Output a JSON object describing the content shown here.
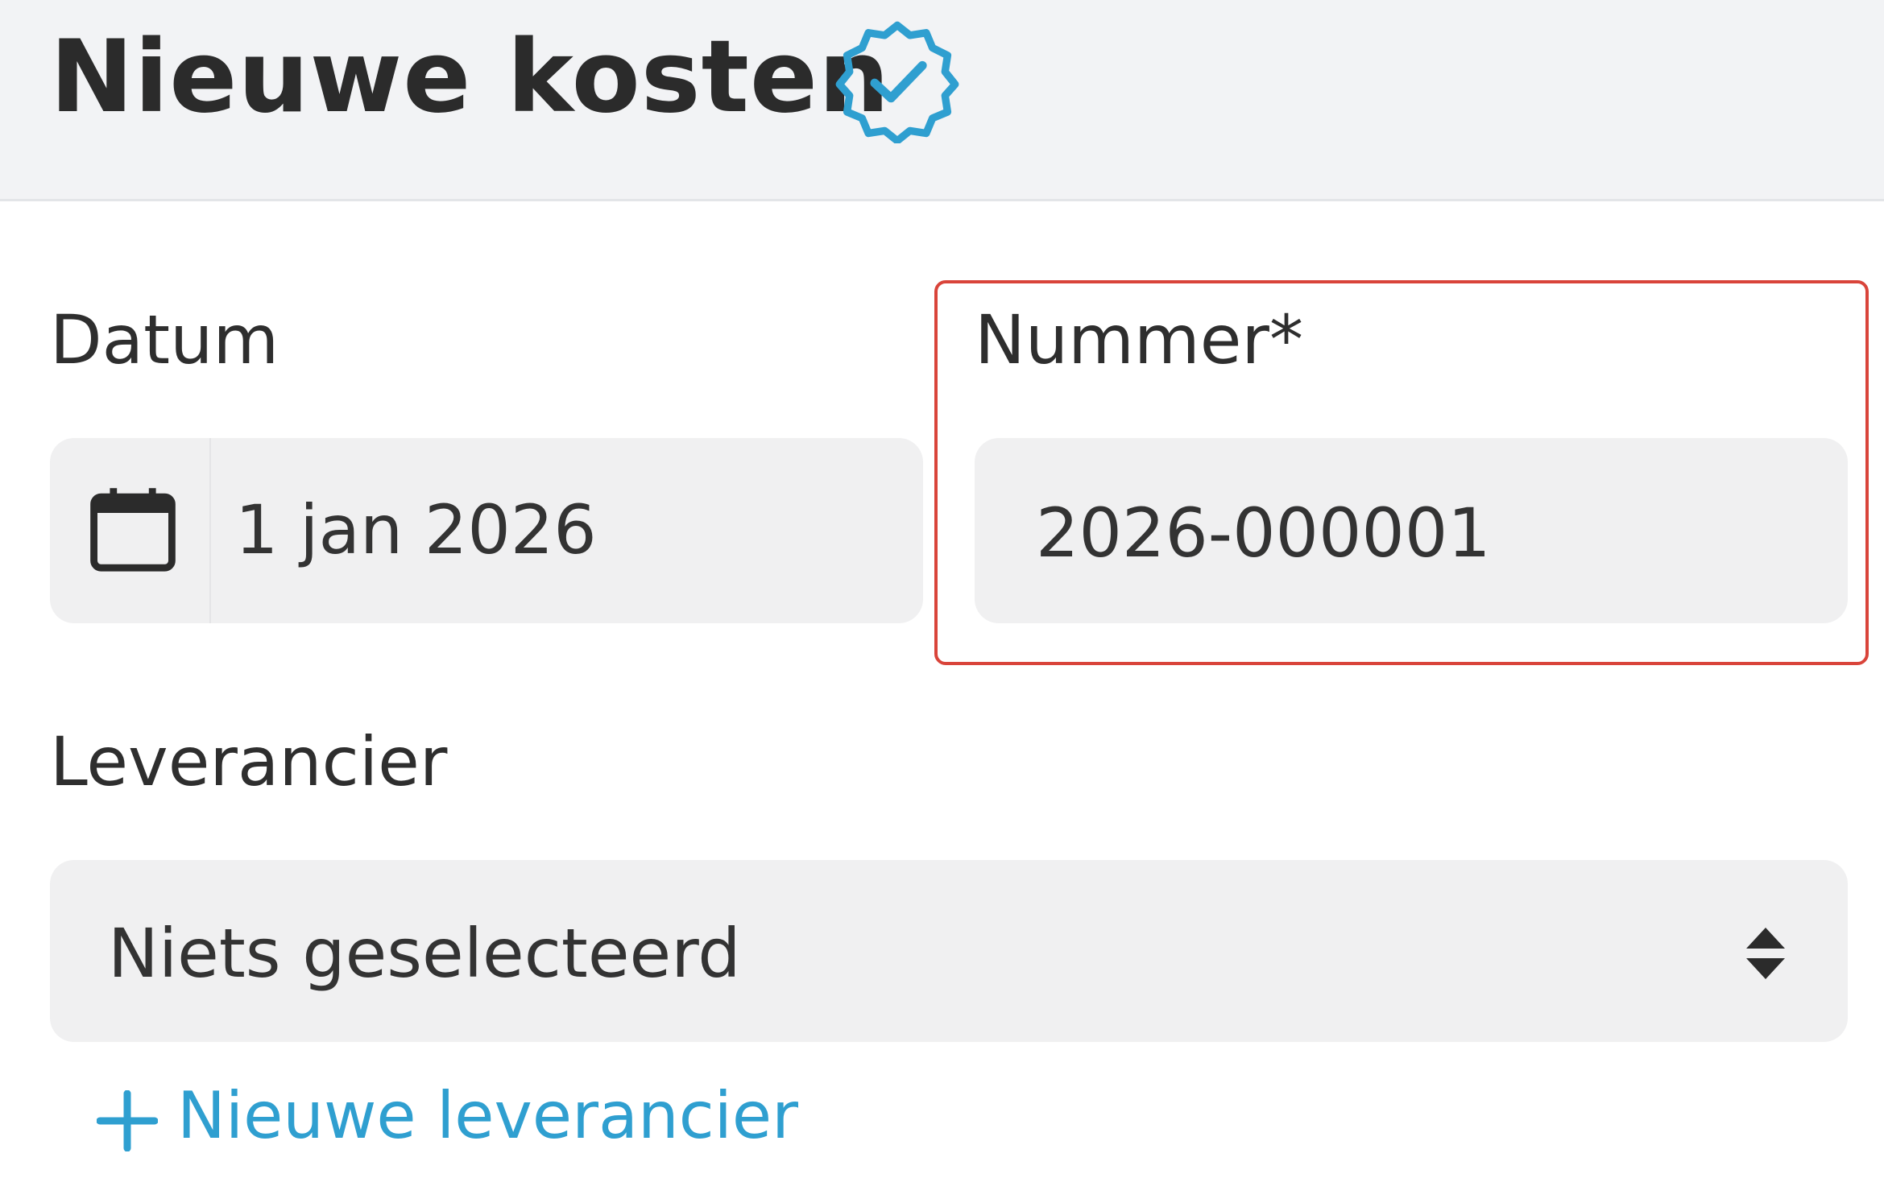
{
  "header": {
    "title": "Nieuwe kosten",
    "verified_icon": "verified-badge-icon"
  },
  "form": {
    "date": {
      "label": "Datum",
      "value": "1 jan 2026",
      "icon": "calendar-icon"
    },
    "number": {
      "label": "Nummer*",
      "value": "2026-000001"
    },
    "supplier": {
      "label": "Leverancier",
      "selected": "Niets geselecteerd",
      "icon": "select-arrows-icon"
    },
    "add_supplier": {
      "label": "Nieuwe leverancier",
      "icon": "plus-icon"
    }
  },
  "colors": {
    "accent": "#2f9fd0",
    "highlight": "#d9443a",
    "header_bg": "#f2f3f5",
    "field_bg": "#f0f0f1"
  }
}
